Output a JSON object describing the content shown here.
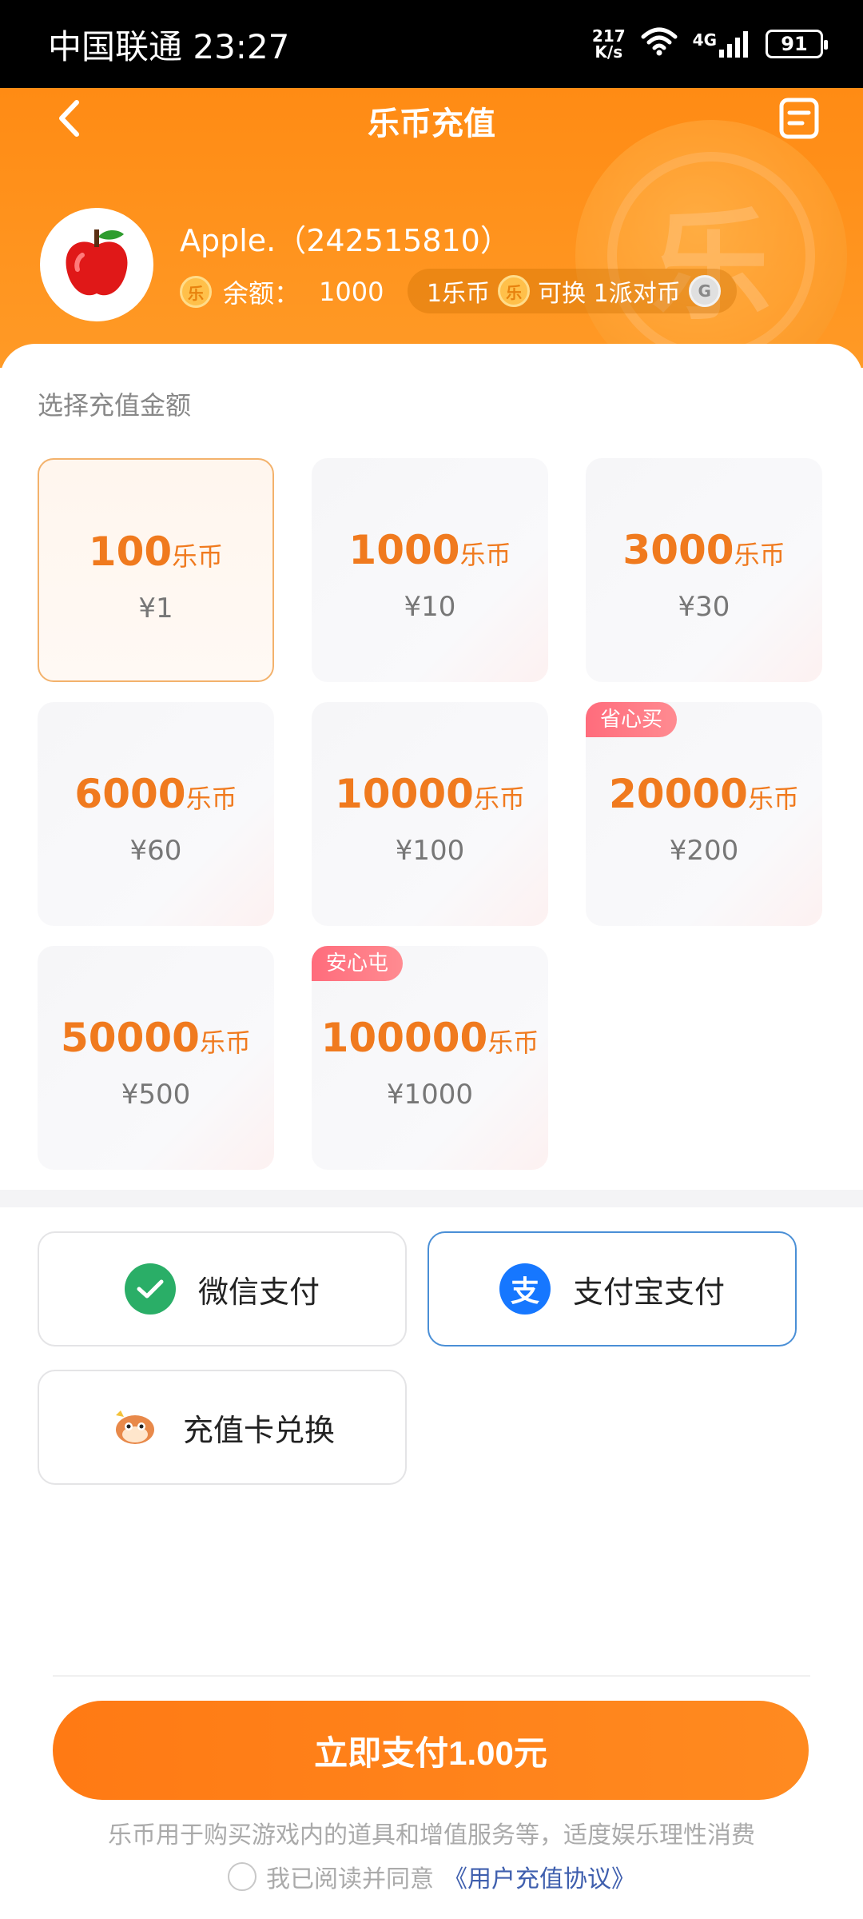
{
  "status_bar": {
    "carrier_time": "中国联通 23:27",
    "net_speed_value": "217",
    "net_speed_unit": "K/s",
    "network": "4G",
    "battery": "91"
  },
  "header": {
    "title": "乐币充值",
    "back_icon": "chevron-left-icon",
    "menu_icon": "document-list-icon",
    "coin_glyph": "乐"
  },
  "user": {
    "name": "Apple.（242515810）",
    "balance_label": "余额：",
    "balance_value": "1000",
    "exchange_text_1": "1乐币",
    "exchange_text_2": "可换 1派对币"
  },
  "recharge": {
    "section_label": "选择充值金额",
    "unit": "乐币",
    "options": [
      {
        "amount": "100",
        "price": "¥1",
        "badge": ""
      },
      {
        "amount": "1000",
        "price": "¥10",
        "badge": ""
      },
      {
        "amount": "3000",
        "price": "¥30",
        "badge": ""
      },
      {
        "amount": "6000",
        "price": "¥60",
        "badge": ""
      },
      {
        "amount": "10000",
        "price": "¥100",
        "badge": ""
      },
      {
        "amount": "20000",
        "price": "¥200",
        "badge": "省心买"
      },
      {
        "amount": "50000",
        "price": "¥500",
        "badge": ""
      },
      {
        "amount": "100000",
        "price": "¥1000",
        "badge": "安心屯"
      }
    ],
    "selected_index": 0
  },
  "payment": {
    "wechat": "微信支付",
    "alipay": "支付宝支付",
    "card": "充值卡兑换",
    "selected": "alipay",
    "colors": {
      "wechat": "#2aae67",
      "alipay": "#1677ff",
      "selected_border": "#4a8fd6"
    }
  },
  "footer": {
    "submit": "立即支付1.00元",
    "notice": "乐币用于购买游戏内的道具和增值服务等，适度娱乐理性消费",
    "agree_text": "我已阅读并同意",
    "agreement_link": "《用户充值协议》"
  },
  "colors": {
    "accent": "#ff8a1c",
    "amount": "#f07a1e",
    "badge": "#ff6c7c"
  }
}
